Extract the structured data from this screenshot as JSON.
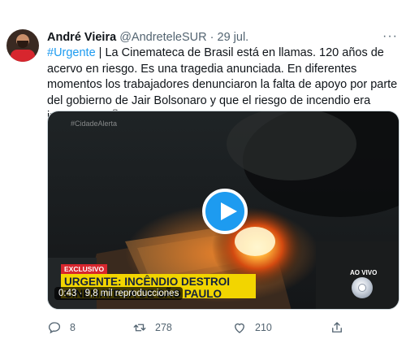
{
  "tweet": {
    "author": {
      "name": "André Vieira",
      "handle": "@AndreteleSUR",
      "separator": "·",
      "date": "29 jul."
    },
    "more_label": "···",
    "text": {
      "hashtag": "#Urgente",
      "body": " | La Cinemateca de Brasil está en llamas. 120 años de acervo en riesgo. Es una tragedia anunciada. En diferentes momentos los trabajadores denunciaron la falta de apoyo por parte del gobierno de Jair Bolsonaro y que el riesgo de incendio era inminente. 📽️Tv Record"
    },
    "video": {
      "watermark": "#CidadeAlerta",
      "exclusive_label": "EXCLUSIVO",
      "headline": "URGENTE: INCÊNDIO DESTROI CINEMATECA DE SÃO PAULO",
      "live_label": "AO VIVO",
      "duration": "0:43",
      "views": "9,8 mil reproducciones",
      "play_icon": "play-icon"
    },
    "actions": {
      "reply_count": "8",
      "retweet_count": "278",
      "like_count": "210"
    },
    "colors": {
      "accent": "#1d9bf0",
      "secondary_text": "#536471",
      "headline_bar": "#f2d500",
      "exclusive_bar": "#d7262e"
    }
  }
}
